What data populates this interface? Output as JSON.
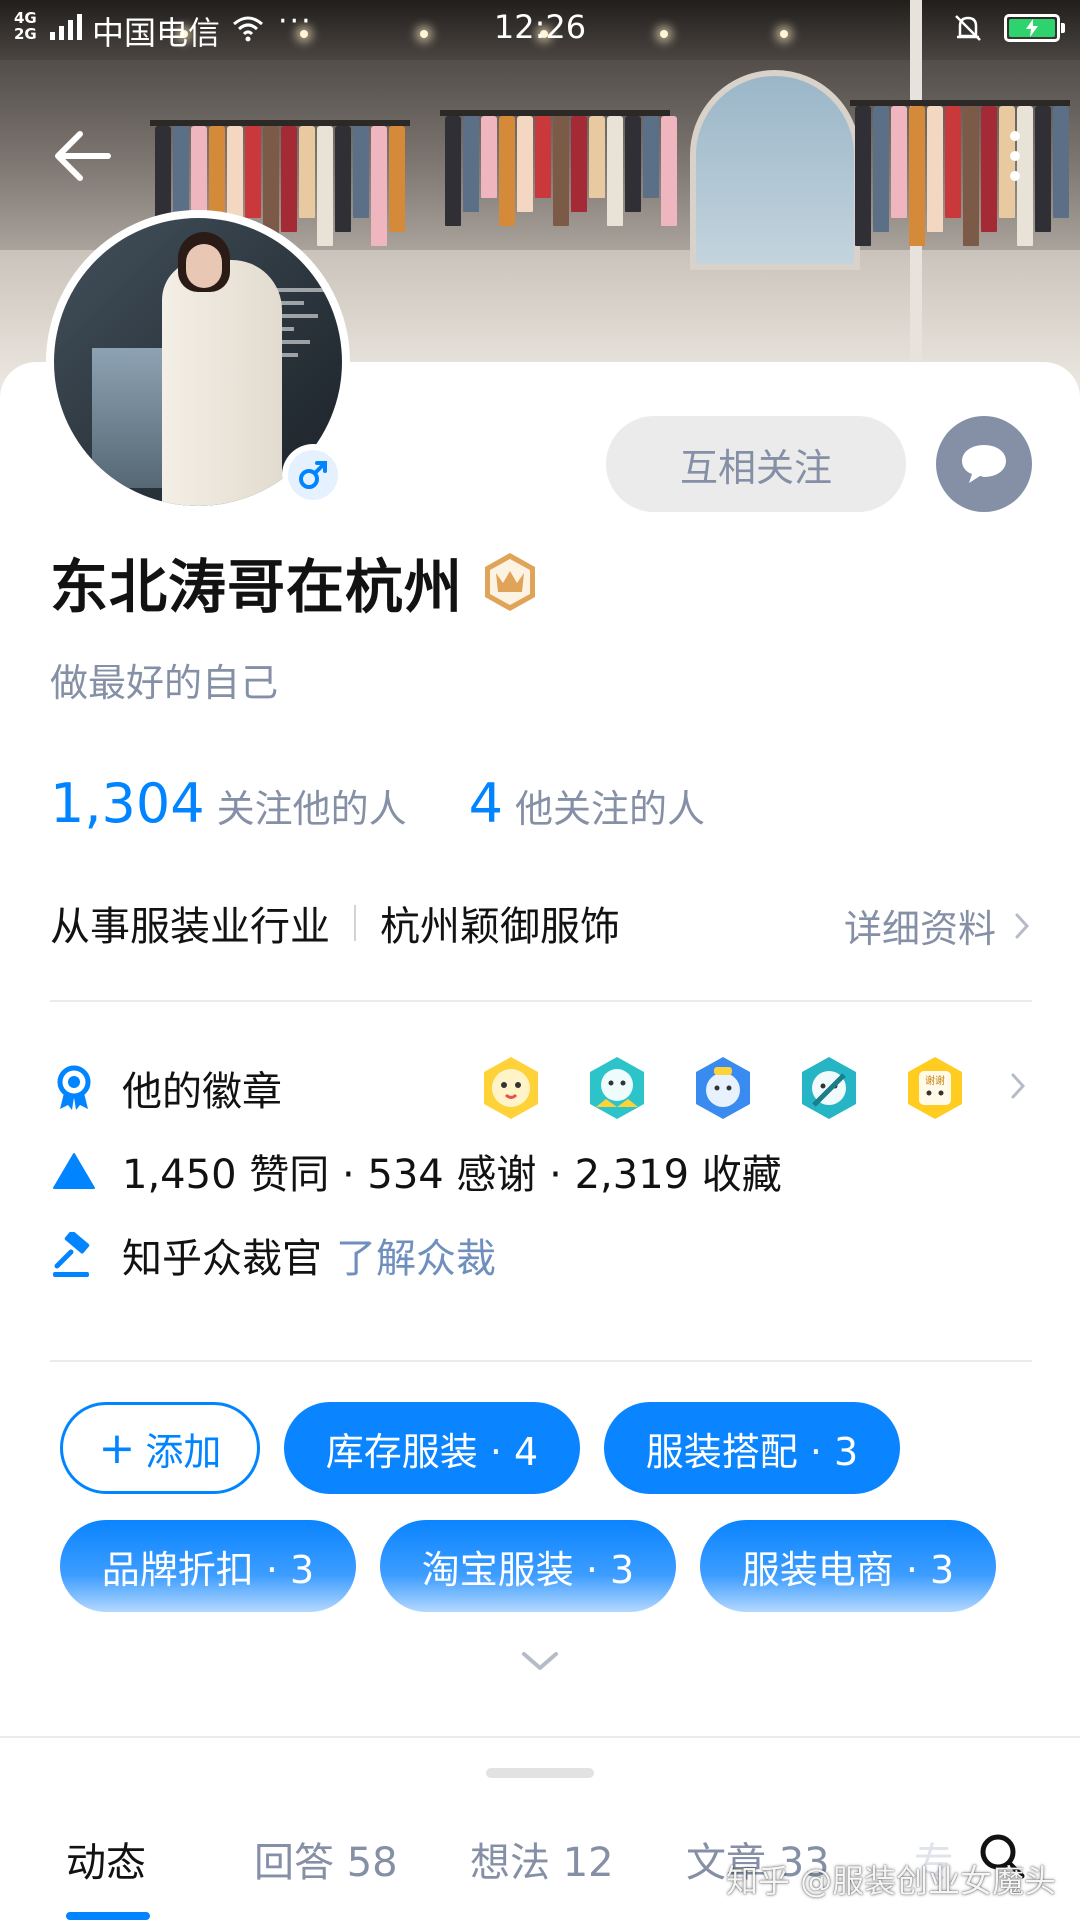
{
  "status_bar": {
    "network_top": "4G",
    "network_bottom": "2G",
    "carrier": "中国电信",
    "more": "···",
    "time": "12:26"
  },
  "profile": {
    "name": "东北涛哥在杭州",
    "headline": "做最好的自己",
    "gender_symbol": "♂",
    "follow_button": "互相关注",
    "followers": {
      "count": "1,304",
      "label": "关注他的人"
    },
    "following": {
      "count": "4",
      "label": "他关注的人"
    },
    "industry": "从事服装业行业",
    "company": "杭州颖御服饰",
    "details_link": "详细资料"
  },
  "badges": {
    "label": "他的徽章",
    "medals": [
      "medal-1",
      "medal-2",
      "medal-3",
      "medal-4",
      "medal-5"
    ],
    "medal_5_text": "谢谢"
  },
  "achievements": {
    "text": "1,450 赞同 · 534 感谢 · 2,319 收藏"
  },
  "moderator": {
    "title": "知乎众裁官",
    "link": "了解众裁"
  },
  "tags": {
    "add_label": "添加",
    "items": [
      {
        "label": "库存服装 · 4"
      },
      {
        "label": "服装搭配 · 3"
      },
      {
        "label": "品牌折扣 · 3"
      },
      {
        "label": "淘宝服装 · 3"
      },
      {
        "label": "服装电商 · 3"
      }
    ]
  },
  "tabs": [
    {
      "label": "动态"
    },
    {
      "label": "回答 58"
    },
    {
      "label": "想法 12"
    },
    {
      "label": "文章 33"
    },
    {
      "label": "专"
    }
  ],
  "watermark": "知乎 @服装创业女魔头",
  "colors": {
    "accent": "#0084ff",
    "secondary_text": "#8590a6",
    "crown": "#e0a458",
    "battery": "#2fd36d"
  }
}
